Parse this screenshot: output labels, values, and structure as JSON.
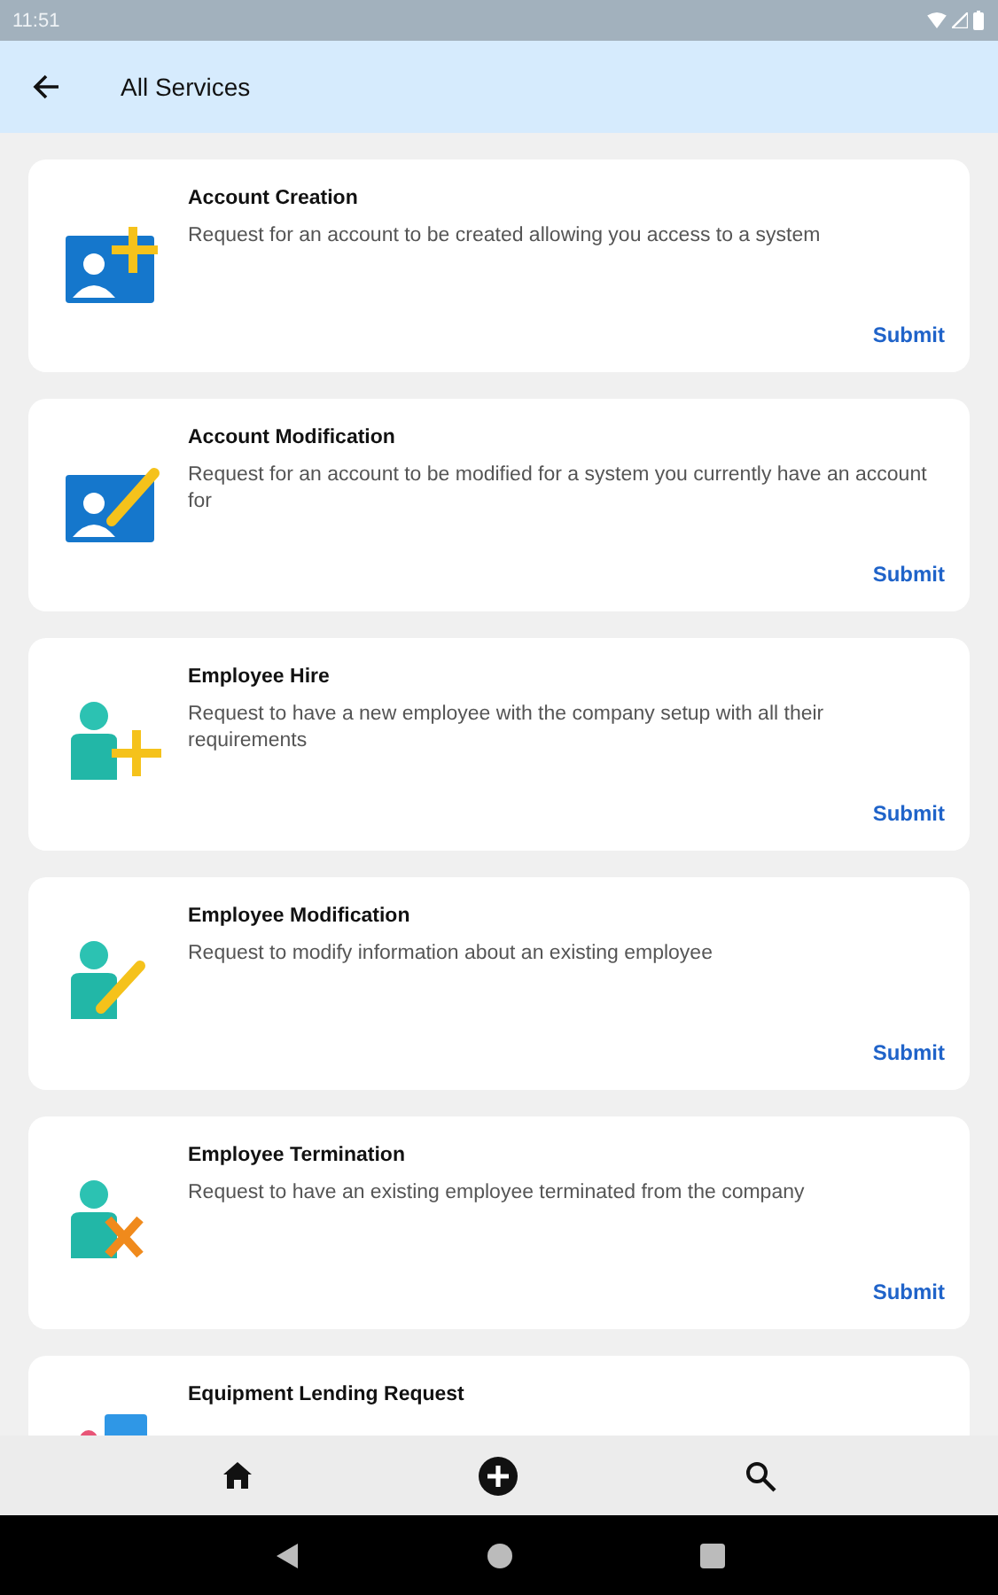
{
  "status_bar": {
    "time": "11:51"
  },
  "app_bar": {
    "title": "All Services"
  },
  "services": [
    {
      "kind": "account-add",
      "title": "Account Creation",
      "description": "Request for an account to be created allowing you access to a system",
      "action": "Submit"
    },
    {
      "kind": "account-edit",
      "title": "Account Modification",
      "description": "Request for an account to be modified for a system you currently have an account for",
      "action": "Submit"
    },
    {
      "kind": "person-add",
      "title": "Employee Hire",
      "description": "Request to have a new employee with the company setup with all their requirements",
      "action": "Submit"
    },
    {
      "kind": "person-edit",
      "title": "Employee Modification",
      "description": "Request to modify information about an existing employee",
      "action": "Submit"
    },
    {
      "kind": "person-remove",
      "title": "Employee Termination",
      "description": "Request to have an existing employee terminated from the company",
      "action": "Submit"
    },
    {
      "kind": "equipment",
      "title": "Equipment Lending Request"
    }
  ],
  "bottom_nav": [
    {
      "kind": "home"
    },
    {
      "kind": "add"
    },
    {
      "kind": "search"
    }
  ]
}
